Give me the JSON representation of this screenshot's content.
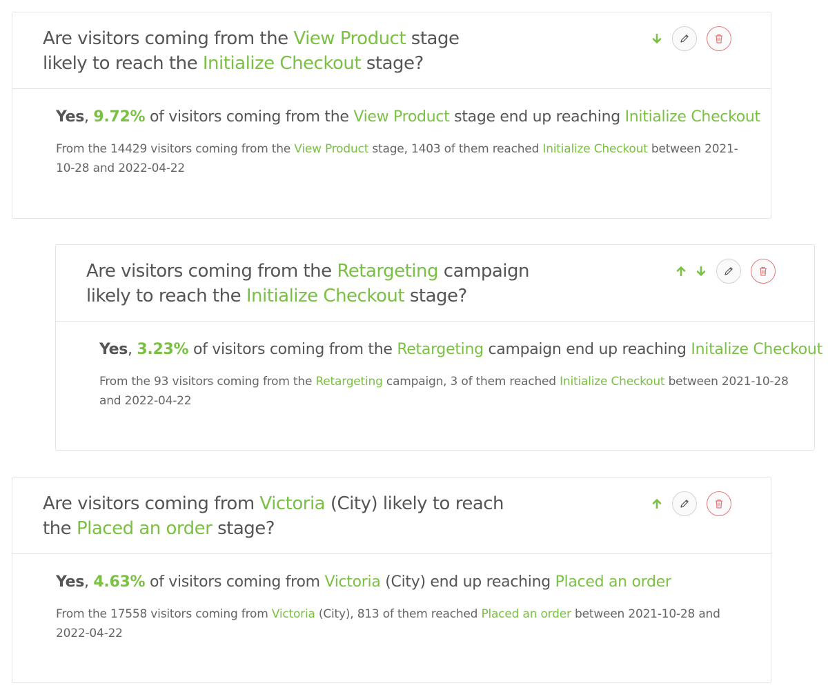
{
  "colors": {
    "accent": "#7ac143",
    "text": "#555555",
    "border": "#e3e3e3",
    "delete": "#e07a7a"
  },
  "icons": {
    "up": "arrow-up-icon",
    "down": "arrow-down-icon",
    "edit": "pencil-icon",
    "delete": "trash-icon"
  },
  "cards": [
    {
      "question": {
        "p1": "Are visitors coming from the ",
        "hl1": "View Product",
        "p2": " stage likely to reach the ",
        "hl2": "Initialize Checkout",
        "p3": " stage?"
      },
      "answer": {
        "yes": "Yes",
        "sep": ", ",
        "pct": "9.72%",
        "p1": " of visitors coming from the ",
        "hl1": "View Product",
        "p2": " stage end up reaching ",
        "hl2": "Initialize Checkout",
        "p3": ""
      },
      "detail": {
        "p1": "From the 14429 visitors coming from the ",
        "hl1": "View Product",
        "p2": " stage, 1403 of them reached ",
        "hl2": "Initialize Checkout",
        "p3": " between 2021-10-28 and 2022-04-22"
      }
    },
    {
      "question": {
        "p1": "Are visitors coming from the ",
        "hl1": "Retargeting",
        "p2": " campaign likely to reach the ",
        "hl2": "Initialize Checkout",
        "p3": " stage?"
      },
      "answer": {
        "yes": "Yes",
        "sep": ", ",
        "pct": "3.23%",
        "p1": " of visitors coming from the ",
        "hl1": "Retargeting",
        "p2": " campaign end up reaching ",
        "hl2": "Initalize Checkout",
        "p3": ""
      },
      "detail": {
        "p1": "From the 93 visitors coming from the ",
        "hl1": "Retargeting",
        "p2": " campaign, 3 of them reached ",
        "hl2": "Initialize Checkout",
        "p3": " between 2021-10-28 and 2022-04-22"
      }
    },
    {
      "question": {
        "p1": "Are visitors coming from ",
        "hl1": "Victoria",
        "p2": " (City) likely to reach the ",
        "hl2": "Placed an order",
        "p3": " stage?"
      },
      "answer": {
        "yes": "Yes",
        "sep": ", ",
        "pct": "4.63%",
        "p1": " of visitors coming from ",
        "hl1": "Victoria",
        "p2": " (City) end up reaching ",
        "hl2": "Placed an order",
        "p3": ""
      },
      "detail": {
        "p1": "From the 17558 visitors coming from ",
        "hl1": "Victoria",
        "p2": " (City), 813 of them reached ",
        "hl2": "Placed an order",
        "p3": " between 2021-10-28 and 2022-04-22"
      }
    }
  ]
}
